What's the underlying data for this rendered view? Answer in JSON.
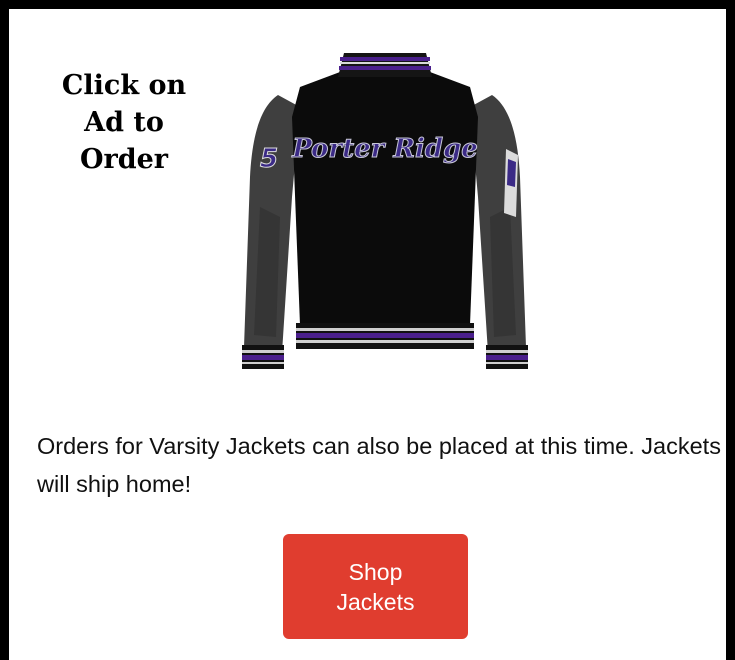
{
  "ad": {
    "cta_lines": [
      "Click on",
      "Ad to",
      "Order"
    ],
    "jacket_script": "Porter Ridge",
    "jacket_number": "5",
    "description": "Orders for Varsity Jackets can also be placed at this time. Jackets will ship home!",
    "button_lines": [
      "Shop",
      "Jackets"
    ]
  },
  "colors": {
    "button": "#e03d2f",
    "jacket_body": "#0b0b0b",
    "jacket_sleeves": "#3f3f3f",
    "accent_purple": "#4a1f8c",
    "border": "#000000"
  },
  "icons": {
    "product": "varsity-jacket-image"
  }
}
